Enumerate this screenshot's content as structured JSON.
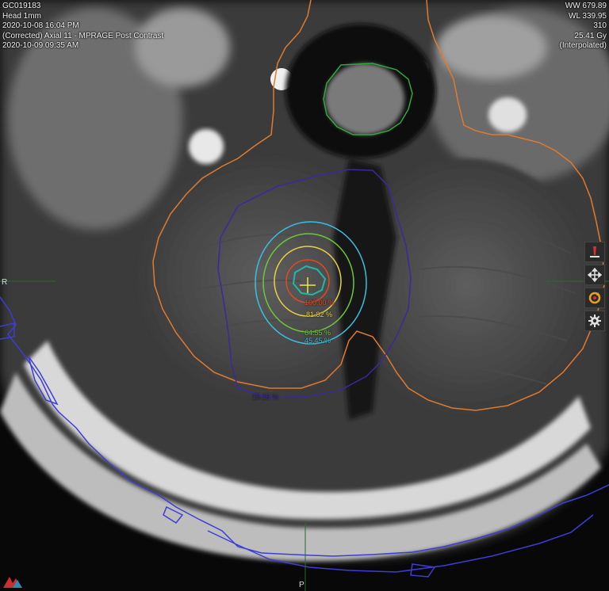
{
  "overlay_top_left": {
    "patient_id": "GC019183",
    "protocol": "Head 1mm",
    "timestamp_1": "2020-10-08 16:04 PM",
    "series": "(Corrected) Axial 11 - MPRAGE Post Contrast",
    "timestamp_2": "2020-10-09 09:35 AM"
  },
  "overlay_top_right": {
    "ww": "WW 679.89",
    "wl": "WL 339.95",
    "slice": "310",
    "dose": "25.41 Gy",
    "interp": "(Interpolated)"
  },
  "orientation": {
    "right": "R",
    "posterior": "P"
  },
  "isodose_labels": {
    "l100": "100.00 %",
    "l81": "81.82 %",
    "l64": "64.55 %",
    "l45": "45.45 %",
    "l15": "15.15 %"
  },
  "colors": {
    "skin_contour": "#3d3dd6",
    "brainstem": "#e07a2e",
    "spinal_cord": "#2fa83c",
    "iso_15": "#3a2a9a",
    "iso_45": "#38c0e0",
    "iso_64": "#6cc838",
    "iso_81": "#e8d040",
    "iso_100": "#e04a20",
    "target": "#20b8a8",
    "crosshair": "#e8e840"
  },
  "toolbar": {
    "tools": [
      "pencil-icon",
      "move-icon",
      "rotate-icon",
      "gear-icon"
    ]
  }
}
